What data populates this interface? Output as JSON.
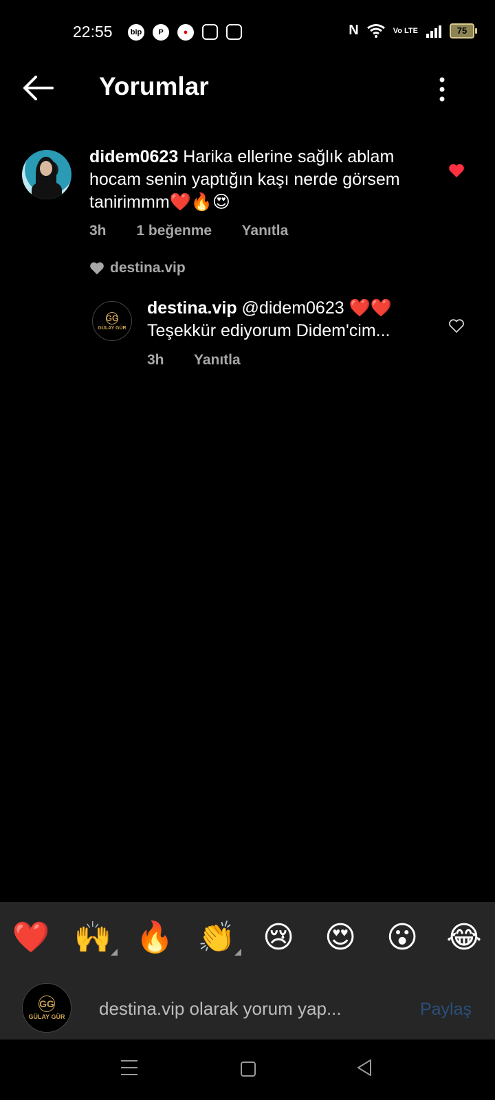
{
  "status": {
    "time": "22:55",
    "app_icons": [
      "bip",
      "pinterest",
      "vodafone",
      "box",
      "instagram"
    ],
    "nfc": "N",
    "volte": "Vo LTE",
    "battery": "75"
  },
  "header": {
    "title": "Yorumlar",
    "back_icon": "arrow-left-icon",
    "more_icon": "more-vertical-icon"
  },
  "comments": [
    {
      "username": "didem0623",
      "text": "Harika ellerine sağlık ablam hocam senin yaptığın kaşı  nerde görsem tanirimmm❤️🔥😍",
      "time": "3h",
      "likes": "1 beğenme",
      "reply": "Yanıtla",
      "liked": true,
      "liked_by": "destina.vip"
    },
    {
      "username": "destina.vip",
      "text": "@didem0623 ❤️❤️ Teşekkür ediyorum Didem'cim...",
      "time": "3h",
      "reply": "Yanıtla",
      "liked": false,
      "avatar_logo": "GG",
      "avatar_text": "GÜLAY GÜR"
    }
  ],
  "emoji_bar": {
    "emojis": [
      "❤️",
      "🙌",
      "🔥",
      "👏",
      "😢",
      "😍",
      "😮",
      "😂"
    ]
  },
  "compose": {
    "placeholder": "destina.vip olarak yorum yap...",
    "share_label": "Paylaş",
    "avatar_logo": "GG",
    "avatar_text": "GÜLAY GÜR"
  },
  "colors": {
    "background": "#000000",
    "bar": "#262626",
    "like_red": "#ff3040",
    "share_disabled": "#2a4e7a"
  }
}
